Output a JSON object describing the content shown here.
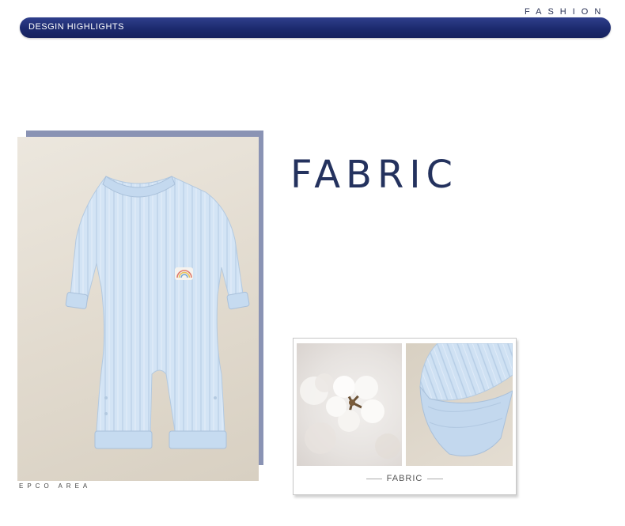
{
  "header": {
    "brand_tag": "FASHION",
    "section_title": "DESGIN HIGHLIGHTS"
  },
  "main_photo": {
    "alt": "Light blue ribbed baby romper with rainbow patch",
    "caption": "EPCO AREA"
  },
  "heading": "FABRIC",
  "detail_card": {
    "caption": "FABRIC"
  },
  "colors": {
    "header_bar": "#1c2a6e",
    "heading_text": "#24325e",
    "backdrop": "#8a93b4",
    "romper_blue": "#cfe2f4"
  }
}
